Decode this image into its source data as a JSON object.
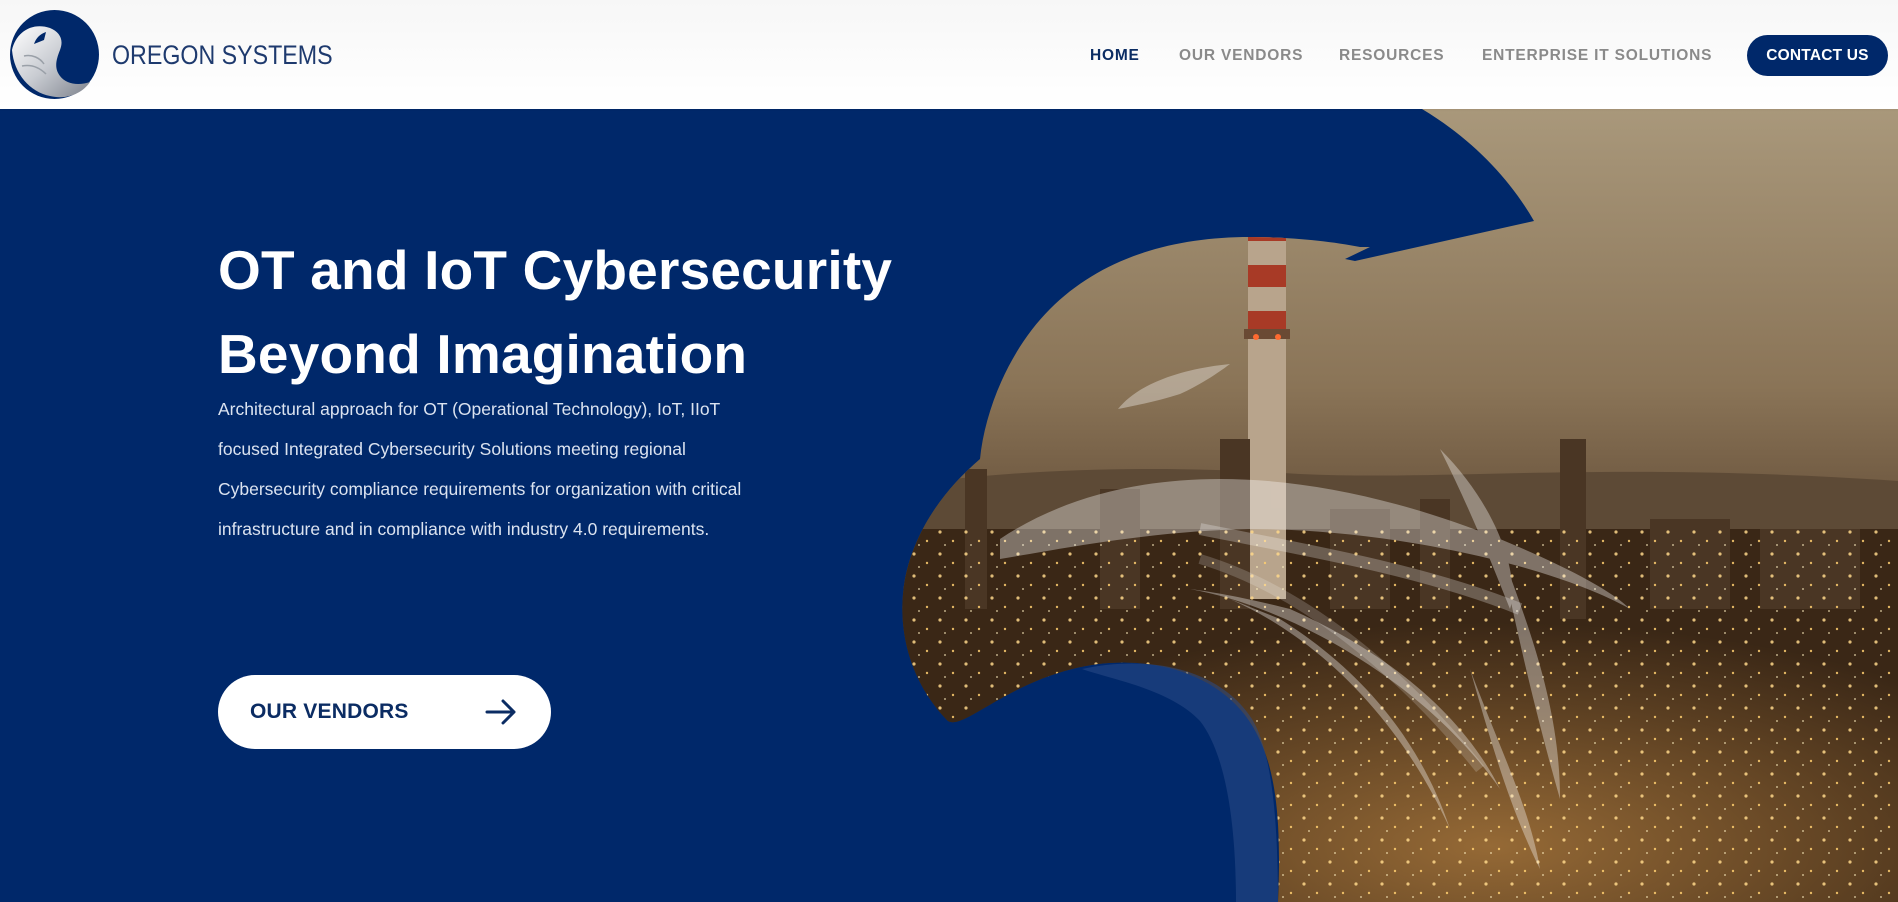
{
  "header": {
    "brand": "OREGON SYSTEMS",
    "logo_icon": "eagle-head-logo-icon",
    "nav": {
      "home": "HOME",
      "vendors": "OUR VENDORS",
      "resources": "RESOURCES",
      "enterprise": "ENTERPRISE IT SOLUTIONS"
    },
    "contact_label": "CONTACT US"
  },
  "hero": {
    "headline_line1": "OT and IoT Cybersecurity",
    "headline_line2": "Beyond Imagination",
    "description_lines": [
      "Architectural approach for OT (Operational Technology), IoT, IIoT",
      "focused Integrated Cybersecurity Solutions meeting regional",
      "Cybersecurity compliance requirements for organization with critical",
      "infrastructure and in compliance with industry 4.0 requirements."
    ],
    "cta_label": "OUR VENDORS",
    "cta_icon": "arrow-right-icon",
    "image_icon": "eagle-silhouette-refinery-image"
  },
  "colors": {
    "brand_navy": "#00286a",
    "nav_active": "#0b2c63",
    "nav_inactive": "#8a8a8a",
    "white": "#ffffff"
  }
}
